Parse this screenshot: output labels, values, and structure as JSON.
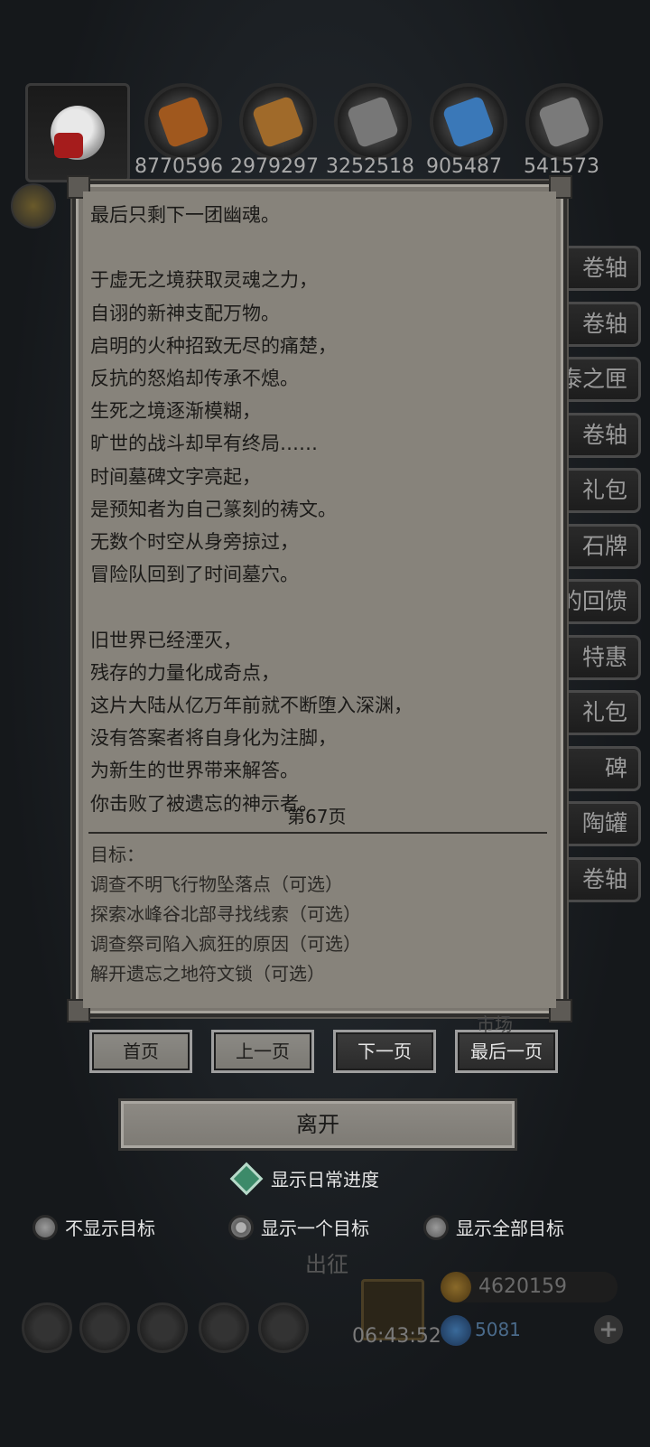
{
  "resources": [
    {
      "icon": "leather-icon",
      "value": "8770596",
      "color": "#a0581e"
    },
    {
      "icon": "wood-icon",
      "value": "2979297",
      "color": "#a06a2a"
    },
    {
      "icon": "stone-icon",
      "value": "3252518",
      "color": "#777777"
    },
    {
      "icon": "crystal-icon",
      "value": "905487",
      "color": "#3a78b8"
    },
    {
      "icon": "iron-icon",
      "value": "541573",
      "color": "#7a7a7a"
    }
  ],
  "side_menu": [
    "卷轴",
    "卷轴",
    "泰之匣",
    "卷轴",
    "礼包",
    "石牌",
    "的回馈",
    "特惠",
    "礼包",
    "碑",
    "陶罐",
    "卷轴"
  ],
  "story": {
    "lines": [
      "最后只剩下一团幽魂。",
      "",
      "于虚无之境获取灵魂之力，",
      "自诩的新神支配万物。",
      "启明的火种招致无尽的痛楚，",
      "反抗的怒焰却传承不熄。",
      "生死之境逐渐模糊，",
      "旷世的战斗却早有终局……",
      "时间墓碑文字亮起，",
      "是预知者为自己篆刻的祷文。",
      "无数个时空从身旁掠过，",
      "冒险队回到了时间墓穴。",
      "",
      "旧世界已经湮灭，",
      "残存的力量化成奇点，",
      "这片大陆从亿万年前就不断堕入深渊，",
      "没有答案者将自身化为注脚，",
      "为新生的世界带来解答。",
      "你击败了被遗忘的神示者。"
    ],
    "page_label": "第67页"
  },
  "goals": {
    "title": "目标：",
    "items": [
      "调查不明飞行物坠落点（可选）",
      "探索冰峰谷北部寻找线索（可选）",
      "调查祭司陷入疯狂的原因（可选）",
      "解开遗忘之地符文锁（可选）"
    ]
  },
  "nav": {
    "first": "首页",
    "prev": "上一页",
    "next": "下一页",
    "last": "最后一页"
  },
  "leave_label": "离开",
  "options": {
    "show_daily": "显示日常进度",
    "hide_goals": "不显示目标",
    "show_one": "显示一个目标",
    "show_all": "显示全部目标",
    "selected": "show_one"
  },
  "background_ui": {
    "expedition": "出征",
    "market": "市场",
    "timer": "06:43:52",
    "gold": "4620159",
    "gems": "5081"
  }
}
